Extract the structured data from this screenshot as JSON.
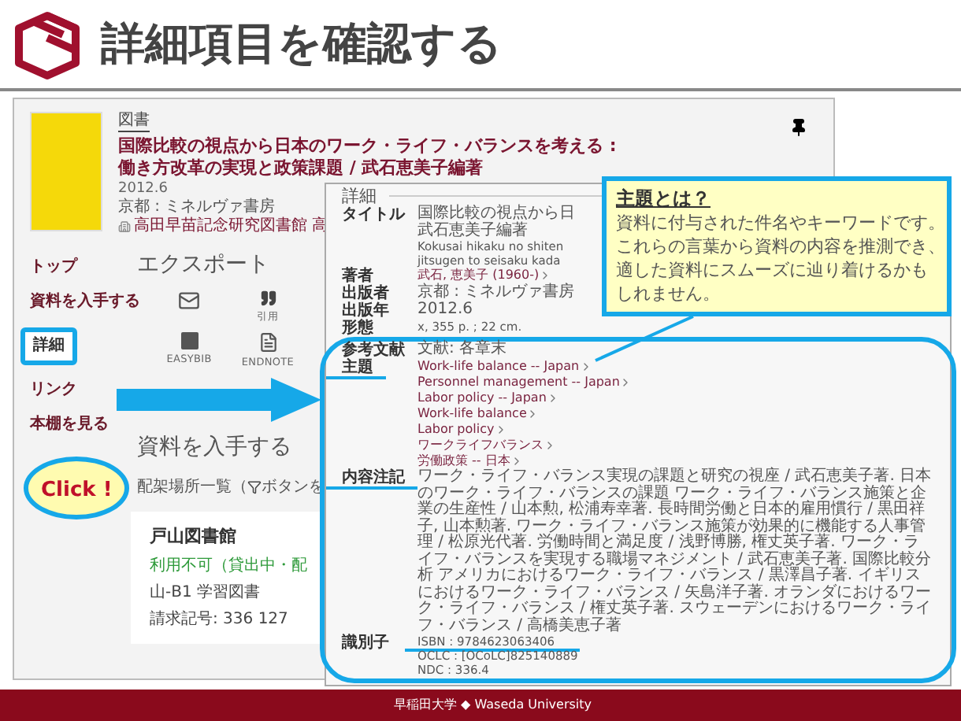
{
  "header": {
    "title": "詳細項目を確認する"
  },
  "record": {
    "type": "図書",
    "title": "国際比較の視点から日本のワーク・ライフ・バランスを考える : 働き方改革の実現と政策課題 / 武石恵美子編著",
    "date": "2012.6",
    "publisher": "京都 : ミネルヴァ書房",
    "holdings": "高田早苗記念研究図書館 高"
  },
  "nav": [
    {
      "label": "トップ",
      "selected": false
    },
    {
      "label": "資料を入手する",
      "selected": false
    },
    {
      "label": "詳細",
      "selected": true
    },
    {
      "label": "リンク",
      "selected": false
    },
    {
      "label": "本棚を見る",
      "selected": false
    }
  ],
  "export": {
    "heading": "エクスポート",
    "items": [
      {
        "kind": "mail"
      },
      {
        "kind": "quote",
        "label": "引用"
      },
      {
        "kind": "easybib",
        "label": "EASYBIB"
      },
      {
        "kind": "endnote",
        "label": "ENDNOTE"
      }
    ]
  },
  "obtain": {
    "heading": "資料を入手する",
    "hint_before": "配架場所一覧（",
    "hint_after": "ボタンを",
    "library": "戸山図書館",
    "status": "利用不可（貸出中・配",
    "location": "山-B1 学習図書",
    "call_number": "請求記号: 336 127"
  },
  "click_bubble": {
    "text": "Click !"
  },
  "detail": {
    "heading": "詳細",
    "fields": [
      {
        "label": "タイトル",
        "underlined": false,
        "lines": [
          {
            "text": "国際比較の視点から日",
            "kind": "plain",
            "underlined": false
          },
          {
            "text": "武石恵美子編著",
            "kind": "plain",
            "underlined": false
          },
          {
            "text": "Kokusai hikaku no shiten",
            "kind": "romaji",
            "underlined": false
          },
          {
            "text": "jitsugen to seisaku kada",
            "kind": "romaji",
            "underlined": false
          }
        ]
      },
      {
        "label": "著者",
        "underlined": false,
        "lines": [
          {
            "text": "武石, 恵美子 (1960-)",
            "kind": "link",
            "underlined": false
          }
        ]
      },
      {
        "label": "出版者",
        "underlined": false,
        "lines": [
          {
            "text": "京都 : ミネルヴァ書房",
            "kind": "plain",
            "underlined": false
          }
        ]
      },
      {
        "label": "出版年",
        "underlined": false,
        "lines": [
          {
            "text": "2012.6",
            "kind": "plain",
            "underlined": false
          }
        ]
      },
      {
        "label": "形態",
        "underlined": false,
        "lines": [
          {
            "text": "x, 355 p. ; 22 cm.",
            "kind": "romaji",
            "underlined": false
          }
        ]
      }
    ],
    "highlighted_fields": [
      {
        "label": "参考文献",
        "underlined": false,
        "lines": [
          {
            "text": "文献: 各章末",
            "kind": "plain",
            "underlined": false
          }
        ]
      },
      {
        "label": "主題",
        "underlined": true,
        "lines": [
          {
            "text": "Work-life balance -- Japan",
            "kind": "link",
            "underlined": false
          },
          {
            "text": "Personnel management -- Japan",
            "kind": "link",
            "underlined": false
          },
          {
            "text": "Labor policy -- Japan",
            "kind": "link",
            "underlined": false
          },
          {
            "text": "Work-life balance",
            "kind": "link",
            "underlined": false
          },
          {
            "text": "Labor policy",
            "kind": "link",
            "underlined": false
          },
          {
            "text": "ワークライフバランス",
            "kind": "link",
            "underlined": false
          },
          {
            "text": "労働政策 -- 日本",
            "kind": "link",
            "underlined": false
          }
        ]
      },
      {
        "label": "内容注記",
        "underlined": true,
        "lines": [
          {
            "text": "ワーク・ライフ・バランス実現の課題と研究の視座 / 武石恵美子著. 日本のワーク・ライフ・バランスの課題 ワーク・ライフ・バランス施策と企業の生産性 / 山本勲, 松浦寿幸著. 長時間労働と日本的雇用慣行 / 黒田祥子, 山本勲著. ワーク・ライフ・バランス施策が効果的に機能する人事管理 / 松原光代著. 労働時間と満足度 / 浅野博勝, 権丈英子著. ワーク・ライフ・バランスを実現する職場マネジメント / 武石恵美子著. 国際比較分析 アメリカにおけるワーク・ライフ・バランス / 黒澤昌子著. イギリスにおけるワーク・ライフ・バランス / 矢島洋子著. オランダにおけるワーク・ライフ・バランス / 権丈英子著. スウェーデンにおけるワーク・ライフ・バランス / 高橋美恵子著",
            "kind": "plain",
            "underlined": false
          }
        ]
      },
      {
        "label": "識別子",
        "underlined": false,
        "lines": [
          {
            "text": "ISBN : 9784623063406",
            "kind": "romaji",
            "underlined": true
          },
          {
            "text": "OCLC : [OCoLC]825140889",
            "kind": "romaji",
            "underlined": false
          },
          {
            "text": "NDC : 336.4",
            "kind": "romaji",
            "underlined": false
          }
        ]
      }
    ]
  },
  "callout": {
    "title": "主題とは？",
    "lines": [
      "資料に付与された件名やキーワードです。",
      "これらの言葉から資料の内容を推測でき、",
      "適した資料にスムーズに辿り着けるかも",
      "しれません。"
    ]
  },
  "footer": {
    "text": "早稲田大学 ◆ Waseda University"
  }
}
